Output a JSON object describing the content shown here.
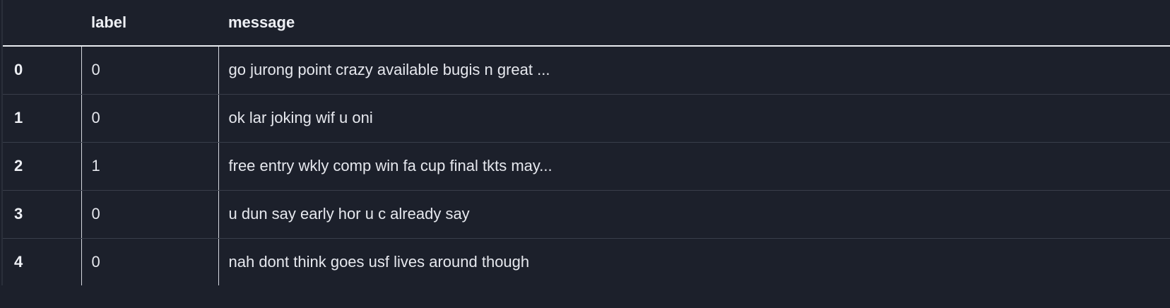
{
  "dataframe": {
    "columns": [
      "",
      "label",
      "message"
    ],
    "rows": [
      {
        "index": "0",
        "label": "0",
        "message": "go jurong point crazy available bugis n great ..."
      },
      {
        "index": "1",
        "label": "0",
        "message": "ok lar joking wif u oni"
      },
      {
        "index": "2",
        "label": "1",
        "message": "free entry wkly comp win fa cup final tkts may..."
      },
      {
        "index": "3",
        "label": "0",
        "message": "u dun say early hor u c already say"
      },
      {
        "index": "4",
        "label": "0",
        "message": "nah dont think goes usf lives around though"
      }
    ]
  },
  "colors": {
    "background": "#1c202b",
    "text": "#e6e8ee",
    "header_rule": "#e9ebf0",
    "row_rule": "#393e4a",
    "column_rule": "#d6d9e0"
  }
}
